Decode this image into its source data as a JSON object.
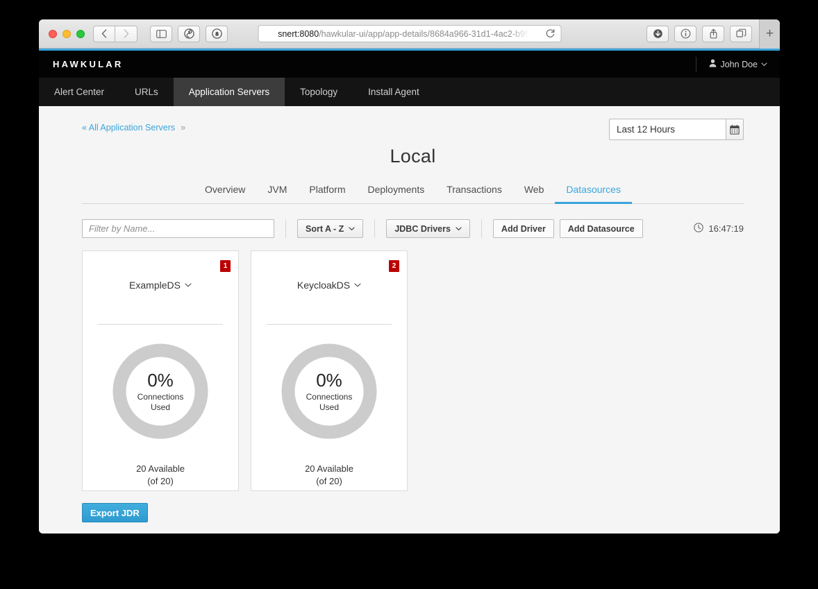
{
  "browser": {
    "url_host": "snert:8080",
    "url_path": "/hawkular-ui/app/app-details/8684a966-31d1-4ac2-b95",
    "back_icon": "chevron-left-icon",
    "forward_icon": "chevron-right-icon",
    "sidebar_icon": "sidebar-icon",
    "reader_icon": "reader-icon",
    "shield_icon": "shield-icon",
    "reload_icon": "reload-icon",
    "download_icon": "download-icon",
    "info_icon": "info-icon",
    "share_icon": "share-icon",
    "tabs_icon": "tabs-icon",
    "new_tab_label": "+"
  },
  "app": {
    "brand": "HAWKULAR",
    "user": {
      "name": "John Doe",
      "icon": "user-icon",
      "caret": "⌄"
    },
    "nav_tabs": [
      {
        "label": "Alert Center",
        "active": false
      },
      {
        "label": "URLs",
        "active": false
      },
      {
        "label": "Application Servers",
        "active": true
      },
      {
        "label": "Topology",
        "active": false
      },
      {
        "label": "Install Agent",
        "active": false
      }
    ],
    "breadcrumb": {
      "link": "« All Application Servers",
      "separator": "»"
    },
    "time_range": {
      "value": "Last 12 Hours",
      "icon": "calendar-icon"
    },
    "page_title": "Local",
    "sub_tabs": [
      {
        "label": "Overview",
        "active": false
      },
      {
        "label": "JVM",
        "active": false
      },
      {
        "label": "Platform",
        "active": false
      },
      {
        "label": "Deployments",
        "active": false
      },
      {
        "label": "Transactions",
        "active": false
      },
      {
        "label": "Web",
        "active": false
      },
      {
        "label": "Datasources",
        "active": true
      }
    ],
    "toolbar": {
      "filter_placeholder": "Filter by Name...",
      "filter_value": "",
      "sort_label": "Sort A - Z",
      "drivers_label": "JDBC Drivers",
      "add_driver_label": "Add Driver",
      "add_datasource_label": "Add Datasource",
      "clock_icon": "clock-icon",
      "clock_time": "16:47:19",
      "caret": "⌄"
    },
    "datasources": [
      {
        "name": "ExampleDS",
        "badge": "1",
        "caret": "⌄",
        "percent": "0%",
        "percent_value": 0,
        "gauge_label_line1": "Connections",
        "gauge_label_line2": "Used",
        "available": "20 Available",
        "total": "(of 20)"
      },
      {
        "name": "KeycloakDS",
        "badge": "2",
        "caret": "⌄",
        "percent": "0%",
        "percent_value": 0,
        "gauge_label_line1": "Connections",
        "gauge_label_line2": "Used",
        "available": "20 Available",
        "total": "(of 20)"
      }
    ],
    "export_button_label": "Export JDR"
  },
  "colors": {
    "accent_blue": "#39a5dc",
    "badge_red": "#bb0000",
    "gauge_track": "#cccccc",
    "nav_bg": "#141414",
    "header_bg": "#030303"
  }
}
